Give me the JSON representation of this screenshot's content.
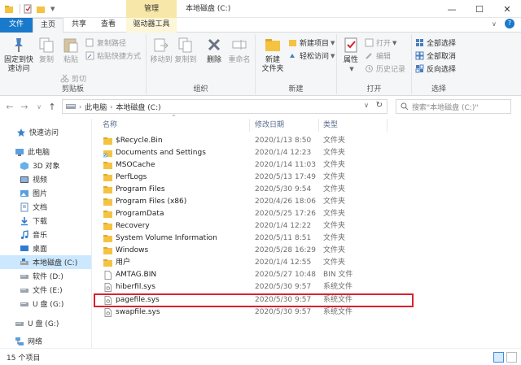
{
  "window": {
    "context_tab": "管理",
    "title": "本地磁盘 (C:)",
    "minimize": "—",
    "maximize": "☐",
    "close": "✕"
  },
  "tabs": {
    "file": "文件",
    "home": "主页",
    "share": "共享",
    "view": "查看",
    "drive_tools": "驱动器工具"
  },
  "ribbon": {
    "clipboard": {
      "label": "剪贴板",
      "pin_line1": "固定到快",
      "pin_line2": "速访问",
      "copy": "复制",
      "paste": "粘贴",
      "copy_path": "复制路径",
      "paste_shortcut": "粘贴快捷方式",
      "cut": "剪切"
    },
    "organize": {
      "label": "组织",
      "move_to": "移动到",
      "copy_to": "复制到",
      "delete": "删除",
      "rename": "重命名"
    },
    "new": {
      "label": "新建",
      "new_folder_line1": "新建",
      "new_folder_line2": "文件夹",
      "new_item": "新建项目",
      "easy_access": "轻松访问"
    },
    "open": {
      "label": "打开",
      "properties": "属性",
      "open": "打开",
      "edit": "编辑",
      "history": "历史记录"
    },
    "select": {
      "label": "选择",
      "select_all": "全部选择",
      "select_none": "全部取消",
      "invert": "反向选择"
    }
  },
  "address": {
    "crumbs": [
      "此电脑",
      "本地磁盘 (C:)"
    ],
    "search_placeholder": "搜索\"本地磁盘 (C:)\""
  },
  "sidebar": {
    "items": [
      {
        "label": "快速访问",
        "icon": "star-icon"
      },
      {
        "label": "此电脑",
        "icon": "computer-icon"
      },
      {
        "label": "3D 对象",
        "icon": "cube-icon"
      },
      {
        "label": "视频",
        "icon": "video-icon"
      },
      {
        "label": "图片",
        "icon": "picture-icon"
      },
      {
        "label": "文档",
        "icon": "document-icon"
      },
      {
        "label": "下载",
        "icon": "download-icon"
      },
      {
        "label": "音乐",
        "icon": "music-icon"
      },
      {
        "label": "桌面",
        "icon": "desktop-icon"
      },
      {
        "label": "本地磁盘 (C:)",
        "icon": "drive-icon"
      },
      {
        "label": "软件 (D:)",
        "icon": "drive-icon"
      },
      {
        "label": "文件 (E:)",
        "icon": "drive-icon"
      },
      {
        "label": "U 盘 (G:)",
        "icon": "usb-drive-icon"
      },
      {
        "label": "U 盘 (G:)",
        "icon": "usb-drive-icon"
      },
      {
        "label": "网络",
        "icon": "network-icon"
      }
    ]
  },
  "columns": {
    "name": "名称",
    "modified": "修改日期",
    "type": "类型"
  },
  "files": [
    {
      "name": "$Recycle.Bin",
      "date": "2020/1/13 8:50",
      "type": "文件夹",
      "icon": "folder-icon"
    },
    {
      "name": "Documents and Settings",
      "date": "2020/1/4 12:23",
      "type": "文件夹",
      "icon": "shortcut-folder-icon"
    },
    {
      "name": "MSOCache",
      "date": "2020/1/14 11:03",
      "type": "文件夹",
      "icon": "folder-icon"
    },
    {
      "name": "PerfLogs",
      "date": "2020/5/13 17:49",
      "type": "文件夹",
      "icon": "folder-icon"
    },
    {
      "name": "Program Files",
      "date": "2020/5/30 9:54",
      "type": "文件夹",
      "icon": "folder-icon"
    },
    {
      "name": "Program Files (x86)",
      "date": "2020/4/26 18:06",
      "type": "文件夹",
      "icon": "folder-icon"
    },
    {
      "name": "ProgramData",
      "date": "2020/5/25 17:26",
      "type": "文件夹",
      "icon": "folder-icon"
    },
    {
      "name": "Recovery",
      "date": "2020/1/4 12:22",
      "type": "文件夹",
      "icon": "folder-icon"
    },
    {
      "name": "System Volume Information",
      "date": "2020/5/11 8:51",
      "type": "文件夹",
      "icon": "folder-icon"
    },
    {
      "name": "Windows",
      "date": "2020/5/28 16:29",
      "type": "文件夹",
      "icon": "folder-icon"
    },
    {
      "name": "用户",
      "date": "2020/1/4 12:55",
      "type": "文件夹",
      "icon": "folder-icon"
    },
    {
      "name": "AMTAG.BIN",
      "date": "2020/5/27 10:48",
      "type": "BIN 文件",
      "icon": "file-icon"
    },
    {
      "name": "hiberfil.sys",
      "date": "2020/5/30 9:57",
      "type": "系统文件",
      "icon": "system-file-icon"
    },
    {
      "name": "pagefile.sys",
      "date": "2020/5/30 9:57",
      "type": "系统文件",
      "icon": "system-file-icon"
    },
    {
      "name": "swapfile.sys",
      "date": "2020/5/30 9:57",
      "type": "系统文件",
      "icon": "system-file-icon"
    }
  ],
  "status": {
    "item_count": "15 个项目"
  },
  "colors": {
    "accent": "#1979ca",
    "folder": "#f5c342",
    "selection": "#cce8ff",
    "highlight_border": "#d9202e"
  }
}
